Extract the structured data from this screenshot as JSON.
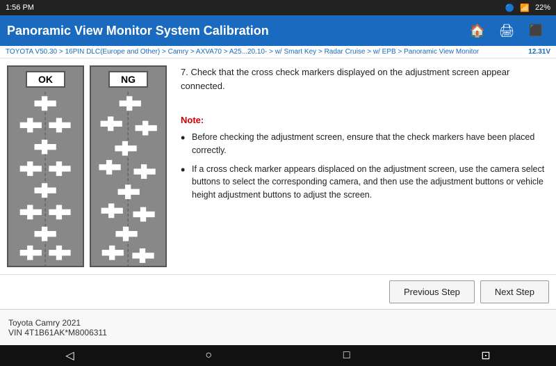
{
  "statusBar": {
    "time": "1:56 PM",
    "battery": "22%"
  },
  "header": {
    "title": "Panoramic View Monitor System Calibration",
    "homeIcon": "🏠",
    "printIcon": "🖨",
    "exitIcon": "➡"
  },
  "breadcrumb": {
    "text": "TOYOTA V50.30 > 16PIN DLC(Europe and Other) > Camry > AXVA70 > A25...20.10- > w/ Smart Key > Radar Cruise > w/ EPB > Panoramic View Monitor",
    "version": "12.31V"
  },
  "stepContent": {
    "stepText": "7. Check that the cross check markers displayed on the adjustment screen appear connected.",
    "noteLabel": "Note:",
    "bullets": [
      "Before checking the adjustment screen, ensure that the check markers have been placed correctly.",
      "If a cross check marker appears displaced on the adjustment screen, use the camera select buttons to select the corresponding camera, and then use the adjustment buttons or vehicle height adjustment buttons to adjust the screen."
    ]
  },
  "diagrams": {
    "ok": {
      "label": "OK"
    },
    "ng": {
      "label": "NG"
    }
  },
  "buttons": {
    "previousStep": "Previous Step",
    "nextStep": "Next Step"
  },
  "footer": {
    "line1": "Toyota Camry 2021",
    "line2": "VIN 4T1B61AK*M8006311"
  },
  "navBar": {
    "back": "◁",
    "home": "○",
    "recent": "□",
    "screenshot": "⊡"
  }
}
